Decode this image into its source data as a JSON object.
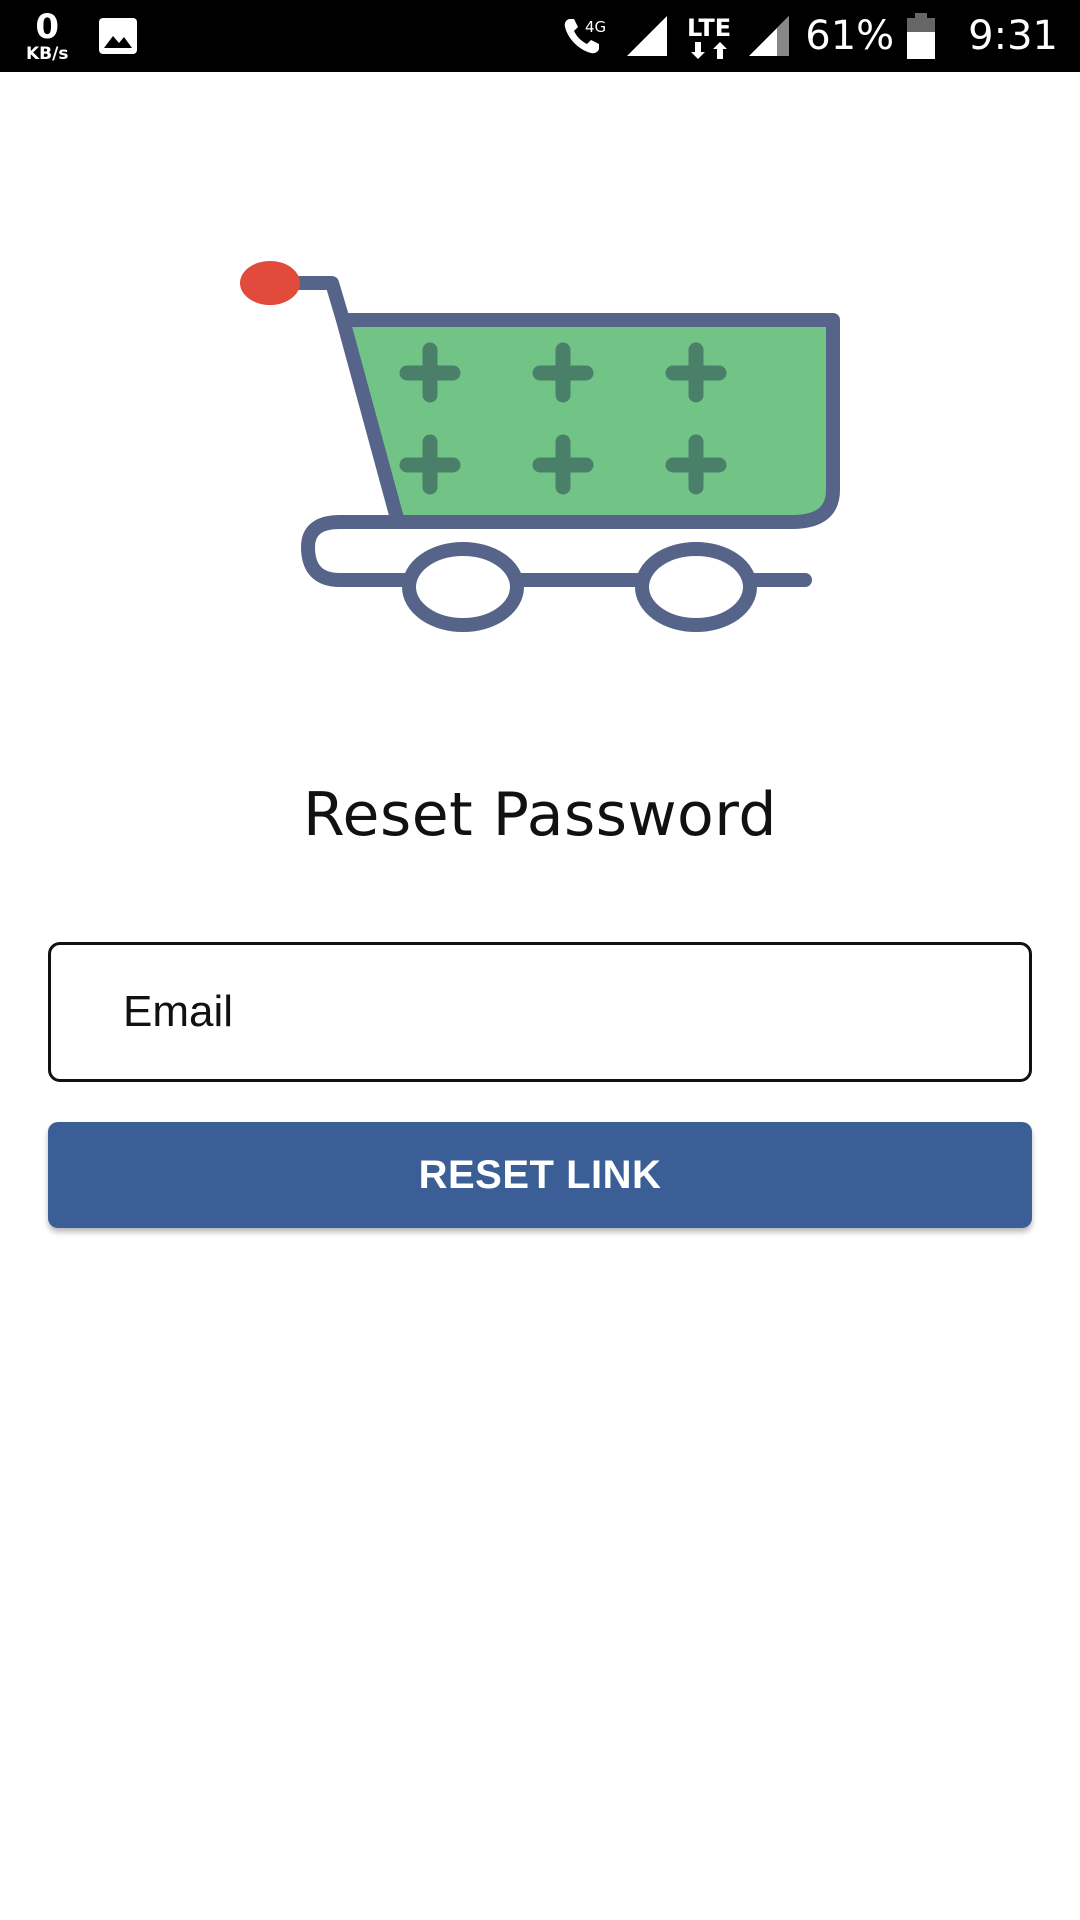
{
  "status_bar": {
    "net_speed_value": "0",
    "net_speed_unit": "KB/s",
    "network_type_call": "4G",
    "network_type_data": "LTE",
    "battery_percent": "61%",
    "time": "9:31",
    "icons": [
      "gallery-icon",
      "wifi-call-icon",
      "signal-icon",
      "lte-data-icon",
      "signal-icon",
      "battery-icon"
    ]
  },
  "logo": {
    "icon": "shopping-cart-icon",
    "colors": {
      "frame": "#56648a",
      "basket": "#72c386",
      "plus": "#4a7f6a",
      "handle": "#e24a3b"
    }
  },
  "page": {
    "title": "Reset Password"
  },
  "form": {
    "email_placeholder": "Email",
    "email_value": "",
    "submit_label": "RESET LINK"
  },
  "theme": {
    "accent": "#3b5e96",
    "status_bar_bg": "#000000",
    "background": "#ffffff"
  }
}
